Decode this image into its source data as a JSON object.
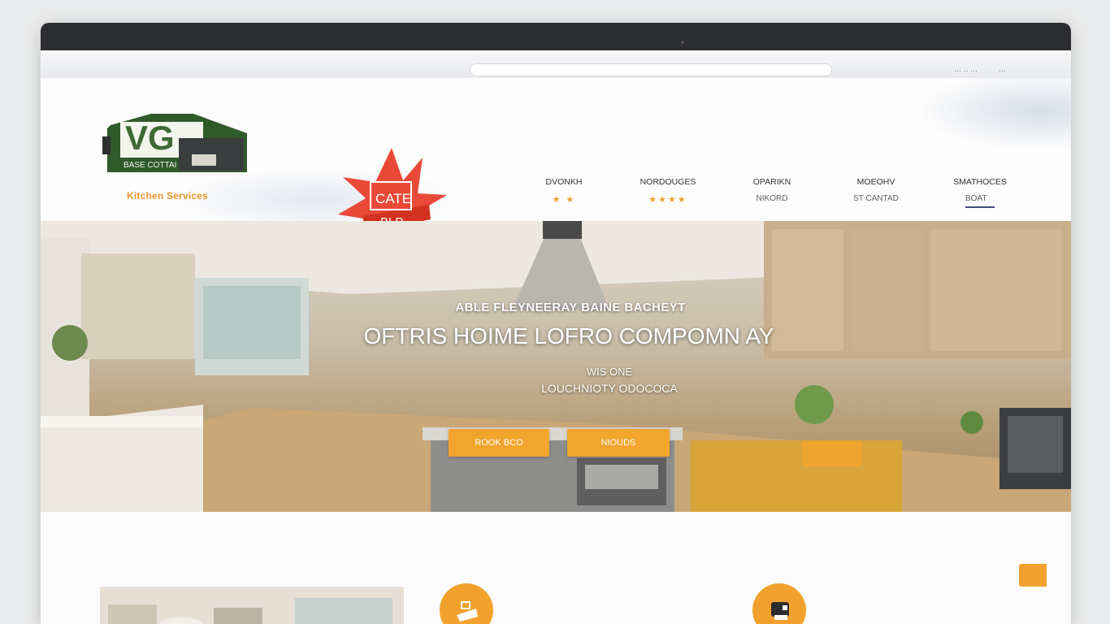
{
  "browser": {
    "top_links": [
      "··· ·· ···",
      "···"
    ]
  },
  "header": {
    "logo_text": "VG",
    "logo_sub": "BASE COTTAI",
    "tagline": "Kitchen Services",
    "badge_line1": "CATE",
    "badge_line2": "BLP"
  },
  "nav": {
    "items": [
      {
        "label": "DVONKH",
        "sub": "★ ★",
        "accent": true
      },
      {
        "label": "NORDOUGES",
        "sub": "★★★★",
        "accent": true
      },
      {
        "label": "OPARIKN",
        "sub": "NIKORD",
        "accent": false
      },
      {
        "label": "MOEOHV",
        "sub": "ST CANTAD",
        "accent": false
      },
      {
        "label": "SMATHOCES",
        "sub": "BOAT",
        "accent": false
      }
    ]
  },
  "hero": {
    "kicker": "ABLE FLEYNEERAY BAINE BACHEYT",
    "title": "OFTRIS HOIME LOFRO COMPOMN AY",
    "sub1": "WIS ONE",
    "sub2": "LOUCHNIOTY ODOCOCA",
    "cta_left": "ROOK BCO",
    "cta_right": "NIOUDS"
  },
  "colors": {
    "accent": "#f2a22c",
    "badge": "#e8402c",
    "titlebar": "#2c2d30",
    "nav_active": "#434a7a"
  }
}
